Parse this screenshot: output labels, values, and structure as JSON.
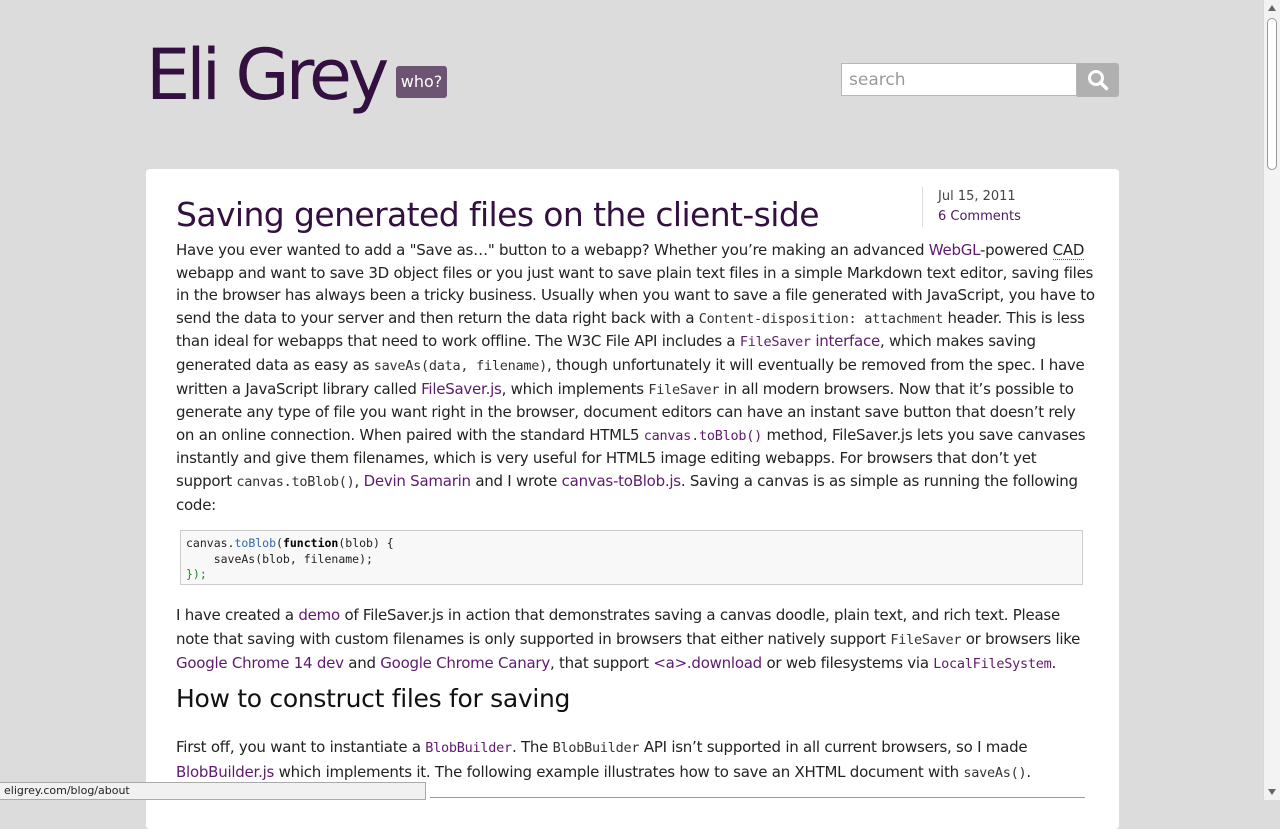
{
  "header": {
    "site_title": "Eli Grey",
    "who_button": "who?",
    "search_placeholder": "search"
  },
  "post": {
    "title": "Saving generated files on the client-side",
    "date": "Jul 15, 2011",
    "comments": "6 Comments",
    "p1": {
      "t1": "Have you ever wanted to add a \"Save as…\" button to a webapp? Whether you’re making an advanced ",
      "l_webgl": "WebGL",
      "t2": "-powered ",
      "abbr_cad": "CAD",
      "t3": " webapp and want to save 3D object files or you just want to save plain text files in a simple Markdown text editor, saving files in the browser has always been a tricky business. Usually when you want to save a file generated with JavaScript, you have to send the data to your server and then return the data right back with a ",
      "c_disposition": "Content-disposition: attachment",
      "t4": " header. This is less than ideal for webapps that need to work offline. The W3C File API includes a ",
      "lc_filesaver": "FileSaver",
      "l_interface": " interface",
      "t5": ", which makes saving generated data as easy as ",
      "c_saveas": "saveAs(data, filename)",
      "t6": ", though unfortunately it will eventually be removed from the spec. I have written a JavaScript library called ",
      "l_filesaverjs": "FileSaver.js",
      "t7": ", which implements ",
      "c_filesaver": "FileSaver",
      "t8": " in all modern browsers. Now that it’s possible to generate any type of file you want right in the browser, document editors can have an instant save button that doesn’t rely on an online connection. When paired with the standard HTML5 ",
      "lc_toblob": "canvas.toBlob()",
      "t9": " method, FileSaver.js lets you save canvases instantly and give them filenames, which is very useful for HTML5 image editing webapps. For browsers that don’t yet support ",
      "c_toblob": "canvas.toBlob()",
      "t10": ", ",
      "l_devin": "Devin Samarin",
      "t11": " and I wrote ",
      "l_canvastoblob": "canvas-toBlob.js",
      "t12": ". Saving a canvas is as simple as running the following code:"
    },
    "code": {
      "l1a": "canvas.",
      "l1b": "toBlob",
      "l1c": "(",
      "l1d": "function",
      "l1e": "(blob) {",
      "l2a": "    saveAs(blob, filename);",
      "l3a": "});"
    },
    "p2": {
      "t1": "I have created a ",
      "l_demo": "demo",
      "t2": " of FileSaver.js in action that demonstrates saving a canvas doodle, plain text, and rich text. Please note that saving with custom filenames is only supported in browsers that either natively support ",
      "c_filesaver": "FileSaver",
      "t3": " or browsers like ",
      "l_chrome14": "Google Chrome 14 dev",
      "t4": " and ",
      "l_canary": "Google Chrome Canary",
      "t5": ", that support ",
      "l_adownload": "<a>.download",
      "t6": " or web filesystems via ",
      "lc_localfs": "LocalFileSystem",
      "t7": "."
    },
    "h2": "How to construct files for saving",
    "p3": {
      "t1": "First off, you want to instantiate a ",
      "lc_blobbuilder": "BlobBuilder",
      "t2": ". The ",
      "c_blobbuilder": "BlobBuilder",
      "t3": " API isn’t supported in all current browsers, so I made ",
      "l_blobbuilderjs": "BlobBuilder.js",
      "t4": " which implements it. The following example illustrates how to save an XHTML document with ",
      "c_saveas": "saveAs()",
      "t5": "."
    }
  },
  "status_bar": "eligrey.com/blog/about"
}
